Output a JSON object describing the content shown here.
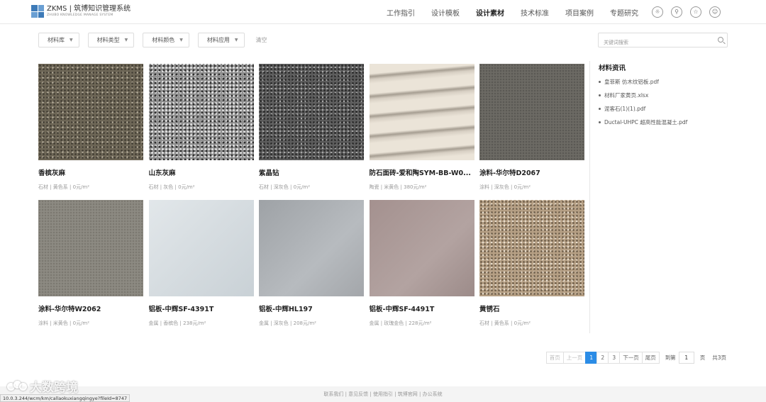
{
  "header": {
    "logo_title": "ZKMS | 筑博知识管理系统",
    "logo_subtitle": "ZHUBO KNOWLEDGE MANAGE SYSTEM",
    "nav": [
      {
        "label": "工作指引",
        "active": false
      },
      {
        "label": "设计模板",
        "active": false
      },
      {
        "label": "设计素材",
        "active": true
      },
      {
        "label": "技术标准",
        "active": false
      },
      {
        "label": "项目案例",
        "active": false
      },
      {
        "label": "专题研究",
        "active": false
      }
    ],
    "icons": [
      "lightbulb-icon",
      "search-icon",
      "star-icon",
      "user-icon"
    ]
  },
  "filters": {
    "dropdowns": [
      "材料库",
      "材料类型",
      "材料颜色",
      "材料应用"
    ],
    "clear_label": "清空",
    "search_placeholder": "关键词搜索"
  },
  "materials": [
    {
      "name": "香槟灰麻",
      "meta": "石材 | 黄色系 | 0元/m²"
    },
    {
      "name": "山东灰麻",
      "meta": "石材 | 灰色 | 0元/m²"
    },
    {
      "name": "紫晶钻",
      "meta": "石材 | 深灰色 | 0元/m²"
    },
    {
      "name": "防石面砖-爱和陶SYM-BB-W0...",
      "meta": "陶瓷 | 米黄色 | 380元/m²"
    },
    {
      "name": "涂料-华尔特D2067",
      "meta": "涂料 | 深灰色 | 0元/m²"
    },
    {
      "name": "涂料-华尔特W2062",
      "meta": "涂料 | 米黄色 | 0元/m²"
    },
    {
      "name": "铝板-中辉SF-4391T",
      "meta": "金属 | 香槟色 | 238元/m²"
    },
    {
      "name": "铝板-中辉HL197",
      "meta": "金属 | 深灰色 | 208元/m²"
    },
    {
      "name": "铝板-中辉SF-4491T",
      "meta": "金属 | 玫瑰金色 | 228元/m²"
    },
    {
      "name": "黄锈石",
      "meta": "石材 | 黄色系 | 0元/m²"
    }
  ],
  "sidebar": {
    "title": "材料资讯",
    "items": [
      "皇菲斯 仿木纹铝板.pdf",
      "材料厂家黄页.xlsx",
      "泥客石(1)(1).pdf",
      "Ductal-UHPC 超高性能混凝土.pdf"
    ]
  },
  "pagination": {
    "first": "首页",
    "prev": "上一页",
    "pages": [
      "1",
      "2",
      "3"
    ],
    "current": "1",
    "next": "下一页",
    "last": "尾页",
    "goto_label": "到第",
    "goto_value": "1",
    "page_unit": "页",
    "total": "共3页"
  },
  "footer": {
    "links": "联系我们 | 意见反馈 | 使用指引 | 筑博官网 | 办公系统"
  },
  "statusbar": {
    "url": "10.0.3.244/wcm/km/callaokuxiangqingye?fileId=8747"
  },
  "watermark": {
    "text": "大数跨境"
  }
}
